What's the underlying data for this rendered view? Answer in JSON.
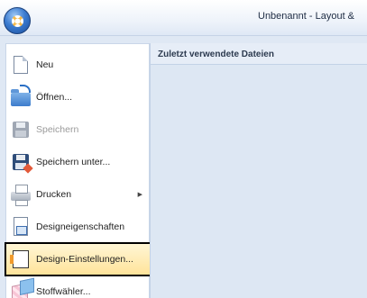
{
  "window": {
    "title": "Unbenannt - Layout &"
  },
  "menu": {
    "items": [
      {
        "label": "Neu",
        "icon": "new-document-icon",
        "disabled": false
      },
      {
        "label": "Öffnen...",
        "icon": "open-folder-icon",
        "disabled": false
      },
      {
        "label": "Speichern",
        "icon": "save-disk-icon",
        "disabled": true
      },
      {
        "label": "Speichern unter...",
        "icon": "save-as-icon",
        "disabled": false
      },
      {
        "label": "Drucken",
        "icon": "printer-icon",
        "disabled": false,
        "submenu_arrow": "▶"
      },
      {
        "label": "Designeigenschaften",
        "icon": "design-properties-icon",
        "disabled": false
      },
      {
        "label": "Design-Einstellungen...",
        "icon": "design-settings-icon",
        "disabled": false,
        "selected": true
      },
      {
        "label": "Stoffwähler...",
        "icon": "fabric-selector-icon",
        "disabled": false
      }
    ]
  },
  "recent": {
    "header": "Zuletzt verwendete Dateien",
    "files": []
  },
  "colors": {
    "accent": "#3b7bd0",
    "selection_border": "#000000",
    "selection_fill": "#ffe39a"
  }
}
